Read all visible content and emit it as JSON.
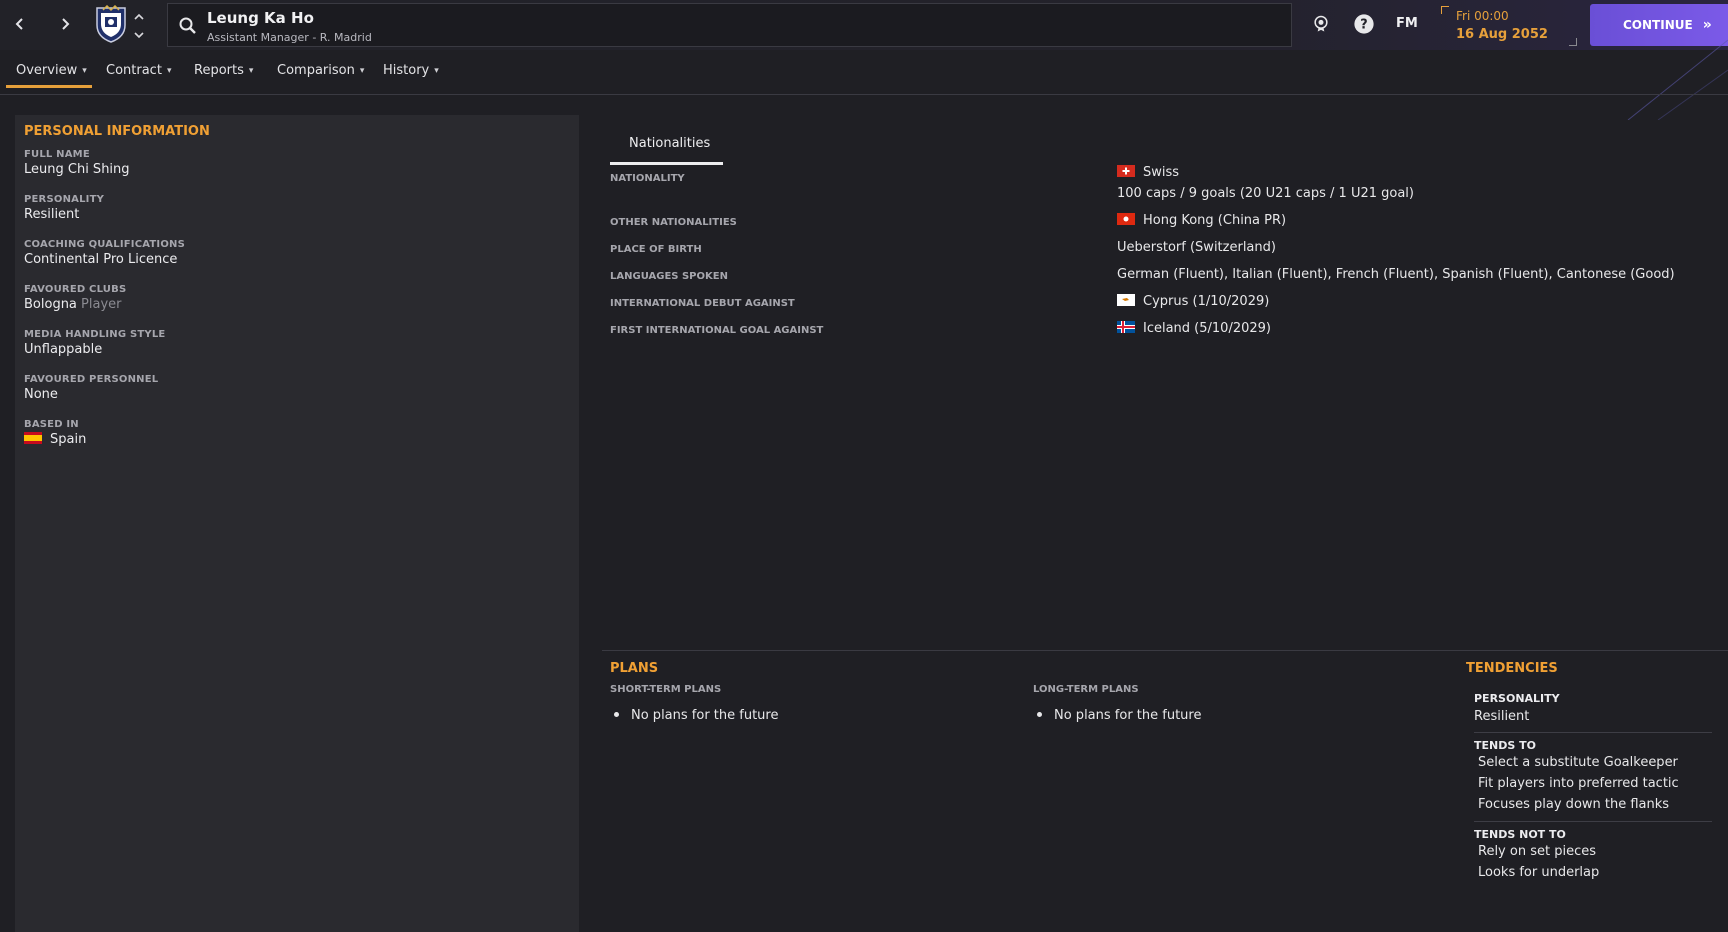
{
  "header": {
    "title": "Leung Ka Ho",
    "subtitle": "Assistant Manager - R. Madrid",
    "fm_label": "FM",
    "time": "Fri 00:00",
    "date": "16 Aug 2052",
    "continue_label": "CONTINUE"
  },
  "tabs": [
    {
      "label": "Overview"
    },
    {
      "label": "Contract"
    },
    {
      "label": "Reports"
    },
    {
      "label": "Comparison"
    },
    {
      "label": "History"
    }
  ],
  "personal_information": {
    "title": "PERSONAL INFORMATION",
    "fields": [
      {
        "label": "FULL NAME",
        "value": "Leung Chi Shing"
      },
      {
        "label": "PERSONALITY",
        "value": "Resilient"
      },
      {
        "label": "COACHING QUALIFICATIONS",
        "value": "Continental Pro Licence"
      },
      {
        "label": "FAVOURED CLUBS",
        "value": "Bologna",
        "suffix": "Player"
      },
      {
        "label": "MEDIA HANDLING STYLE",
        "value": "Unflappable"
      },
      {
        "label": "FAVOURED PERSONNEL",
        "value": "None"
      },
      {
        "label": "BASED IN",
        "value": "Spain",
        "flag": "spain"
      }
    ]
  },
  "nationalities": {
    "tab_label": "Nationalities",
    "rows": [
      {
        "label": "NATIONALITY",
        "value": "Swiss",
        "value2": "100 caps / 9 goals (20 U21 caps / 1 U21 goal)",
        "flag": "switzerland"
      },
      {
        "label": "OTHER NATIONALITIES",
        "value": "Hong Kong (China PR)",
        "flag": "hong-kong"
      },
      {
        "label": "PLACE OF BIRTH",
        "value": "Ueberstorf (Switzerland)"
      },
      {
        "label": "LANGUAGES SPOKEN",
        "value": "German (Fluent), Italian (Fluent), French (Fluent), Spanish (Fluent), Cantonese (Good)"
      },
      {
        "label": "INTERNATIONAL DEBUT AGAINST",
        "value": "Cyprus (1/10/2029)",
        "flag": "cyprus"
      },
      {
        "label": "FIRST INTERNATIONAL GOAL AGAINST",
        "value": "Iceland (5/10/2029)",
        "flag": "iceland"
      }
    ]
  },
  "plans": {
    "title": "PLANS",
    "short_term": {
      "label": "SHORT-TERM PLANS",
      "items": [
        "No plans for the future"
      ]
    },
    "long_term": {
      "label": "LONG-TERM PLANS",
      "items": [
        "No plans for the future"
      ]
    }
  },
  "tendencies": {
    "title": "TENDENCIES",
    "personality_label": "PERSONALITY",
    "personality_value": "Resilient",
    "tends_to_label": "TENDS TO",
    "tends_to": [
      "Select a substitute Goalkeeper",
      "Fit players into preferred tactic",
      "Focuses play down the flanks"
    ],
    "tends_not_to_label": "TENDS NOT TO",
    "tends_not_to": [
      "Rely on set pieces",
      "Looks for underlap"
    ]
  },
  "colors": {
    "accent": "#f0a034",
    "continue": "#7055e0",
    "background": "#1f1f24",
    "panel": "#2a2a2f"
  }
}
